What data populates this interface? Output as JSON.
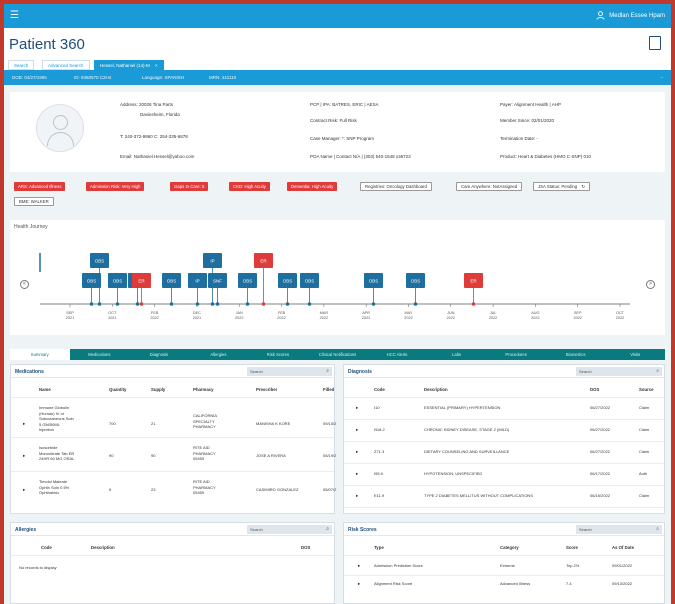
{
  "app": {
    "menu_icon": "hamburger-icon",
    "user_icon": "user-icon",
    "user_name": "Medlan Essee Hpam",
    "page_title": "Patient 360",
    "pdf_icon": "pdf-icon"
  },
  "tabs": [
    {
      "label": "Search"
    },
    {
      "label": "Advanced Search"
    },
    {
      "label": "Hessel, Nathaniel (14)-M",
      "close": "×"
    }
  ],
  "idbar": {
    "dob": "DOB: 04/27/1955",
    "id": "ID: 8360570 C2H4",
    "language": "Language: SPANISH",
    "mrn": "MRN: 441110",
    "collapse_icon": "–"
  },
  "patient": {
    "address_label": "Address: 20026 Tina Parts",
    "address_city": "Daviesheim, Florida",
    "phone": "T: 240-372-9960 C: 254-335-6878",
    "email": "Email: Nathaniel.Hessel@yahoo.com",
    "pcp": "PCP | IPA: BATRES, ERIC | AESA",
    "contract_risk": "Contract Risk: Full Risk",
    "case_manager": "Case Manager: *: SNP Program",
    "poa": "POA Name | Contact N/A | (303) 540-1548 x36723",
    "payer": "Payer: Alignment Health | AHP",
    "member_since": "Member Since: 02/01/2020",
    "termination": "Termination Date: -",
    "product": "Product: Heart & Diabetes (HMO C-SNP) 010"
  },
  "flags": {
    "red": [
      "ARS: Advanced Illness",
      "Admission Risk: Very High",
      "Gaps In Care: 5",
      "CKD: High Acuity",
      "Dementia: High Acuity"
    ],
    "white": [
      "Registries: Oncology Dashboard",
      "Care Anywhere: NotAssigned",
      "JSA Status: Pending"
    ],
    "jsa_refresh_icon": "↻",
    "second_row": [
      "BME: WALKER"
    ]
  },
  "journey": {
    "title": "Health Journey",
    "left_icon": "<",
    "right_icon": ">",
    "events": [
      {
        "label": "OBS",
        "color": "blue",
        "row": 2
      },
      {
        "label": "OBS",
        "color": "blue",
        "row": 1
      },
      {
        "label": "OBS",
        "color": "blue",
        "row": 2
      },
      {
        "label": "OBS",
        "color": "blue",
        "row": 2
      },
      {
        "label": "ER",
        "color": "red",
        "row": 2
      },
      {
        "label": "OBS",
        "color": "blue",
        "row": 2
      },
      {
        "label": "IP",
        "color": "blue",
        "row": 2
      },
      {
        "label": "IP",
        "color": "blue",
        "row": 1
      },
      {
        "label": "SNF",
        "color": "blue",
        "row": 2
      },
      {
        "label": "OBS",
        "color": "blue",
        "row": 2
      },
      {
        "label": "ER",
        "color": "red",
        "row": 1
      },
      {
        "label": "OBS",
        "color": "blue",
        "row": 2
      },
      {
        "label": "OBS",
        "color": "blue",
        "row": 2
      },
      {
        "label": "OBS",
        "color": "blue",
        "row": 2
      },
      {
        "label": "OBS",
        "color": "blue",
        "row": 2
      },
      {
        "label": "ER",
        "color": "red",
        "row": 2
      }
    ],
    "ticks": [
      {
        "m": "SEP",
        "y": "2021"
      },
      {
        "m": "OCT",
        "y": "2021"
      },
      {
        "m": "FEB",
        "y": "2022"
      },
      {
        "m": "DEC",
        "y": "2021"
      },
      {
        "m": "JAN",
        "y": "2022"
      },
      {
        "m": "FEB",
        "y": "2022"
      },
      {
        "m": "MAR",
        "y": "2022"
      },
      {
        "m": "APR",
        "y": "2022"
      },
      {
        "m": "MAY",
        "y": "2022"
      },
      {
        "m": "JUN",
        "y": "2022"
      },
      {
        "m": "JUL",
        "y": "2022"
      },
      {
        "m": "AUG",
        "y": "2022"
      },
      {
        "m": "SEP",
        "y": "2022"
      },
      {
        "m": "OCT",
        "y": "2022"
      }
    ]
  },
  "nav": [
    "Summary",
    "Medications",
    "Diagnosis",
    "Allergies",
    "Risk Scores",
    "Clinical Notifications",
    "HCC Alerts",
    "Labs",
    "Procedures",
    "Biometrics",
    "Visits"
  ],
  "medications": {
    "title": "Medications",
    "search_placeholder": "Search",
    "search_icon": "search-icon",
    "headers": [
      "Name",
      "Quantity",
      "Supply",
      "Pharmacy",
      "Prescriber",
      "Filled"
    ],
    "rows": [
      {
        "name": [
          "Immune Globulin",
          "(Human) IV or",
          "Subcutaneous Soln",
          "5 GM/50ML",
          "Injection"
        ],
        "quantity": "700",
        "supply": "21",
        "pharmacy": [
          "CALIFORNIA",
          "SPECIALTY",
          "PHARMACY"
        ],
        "prescriber": "MANISHA K KORE",
        "filled": "09/15/2"
      },
      {
        "name": [
          "Isosorbide",
          "Mononitrate Tab ER",
          "24HR 60 MG ORAL"
        ],
        "quantity": "90",
        "supply": "90",
        "pharmacy": [
          "RITE AID",
          "PHARMACY",
          "05459"
        ],
        "prescriber": "JOSE A RIVERA",
        "filled": "05/19/2"
      },
      {
        "name": [
          "Timolol Maleate",
          "Ophth Soln 0.5%",
          "Ophthalmic"
        ],
        "quantity": "5",
        "supply": "23",
        "pharmacy": [
          "RITE AID",
          "PHARMACY",
          "05459"
        ],
        "prescriber": "CASIMIRO GONZALEZ",
        "filled": "05/07/2"
      }
    ]
  },
  "diagnosis": {
    "title": "Diagnosis",
    "search_placeholder": "Search",
    "headers": [
      "Code",
      "Description",
      "DOS",
      "Source"
    ],
    "rows": [
      {
        "code": "I10",
        "desc": "ESSENTIAL (PRIMARY) HYPERTENSION",
        "dos": "06/27/2022",
        "source": "Claim"
      },
      {
        "code": "N18.2",
        "desc": "CHRONIC KIDNEY DISEASE, STAGE 2 (MILD)",
        "dos": "06/27/2022",
        "source": "Claim"
      },
      {
        "code": "Z71.3",
        "desc": "DIETARY COUNSELING AND SURVEILLANCE",
        "dos": "06/27/2022",
        "source": "Claim"
      },
      {
        "code": "I95.9",
        "desc": "HYPOTENSION, UNSPECIFIED",
        "dos": "06/17/2022",
        "source": "Auth"
      },
      {
        "code": "E11.9",
        "desc": "TYPE 2 DIABETES MELLITUS WITHOUT COMPLICATIONS",
        "dos": "06/16/2022",
        "source": "Claim"
      }
    ]
  },
  "allergies": {
    "title": "Allergies",
    "search_placeholder": "Search",
    "headers": [
      "Code",
      "Description",
      "DOS"
    ],
    "empty": "No records to display"
  },
  "risk": {
    "title": "Risk Scores",
    "search_placeholder": "Search",
    "headers": [
      "Type",
      "Category",
      "Score",
      "As Of Date"
    ],
    "rows": [
      {
        "type": "Admission Prediction Score",
        "category": "Extreme",
        "score": "Top 2%",
        "date": "09/01/2022"
      },
      {
        "type": "Alignment Risk Score",
        "category": "Advanced Illness",
        "score": "7.4",
        "date": "09/13/2022"
      }
    ]
  },
  "colors": {
    "brand": "#1a9ad6",
    "nav": "#0a7a7e",
    "alert": "#e03b3b",
    "event_blue": "#1e6fa0"
  }
}
